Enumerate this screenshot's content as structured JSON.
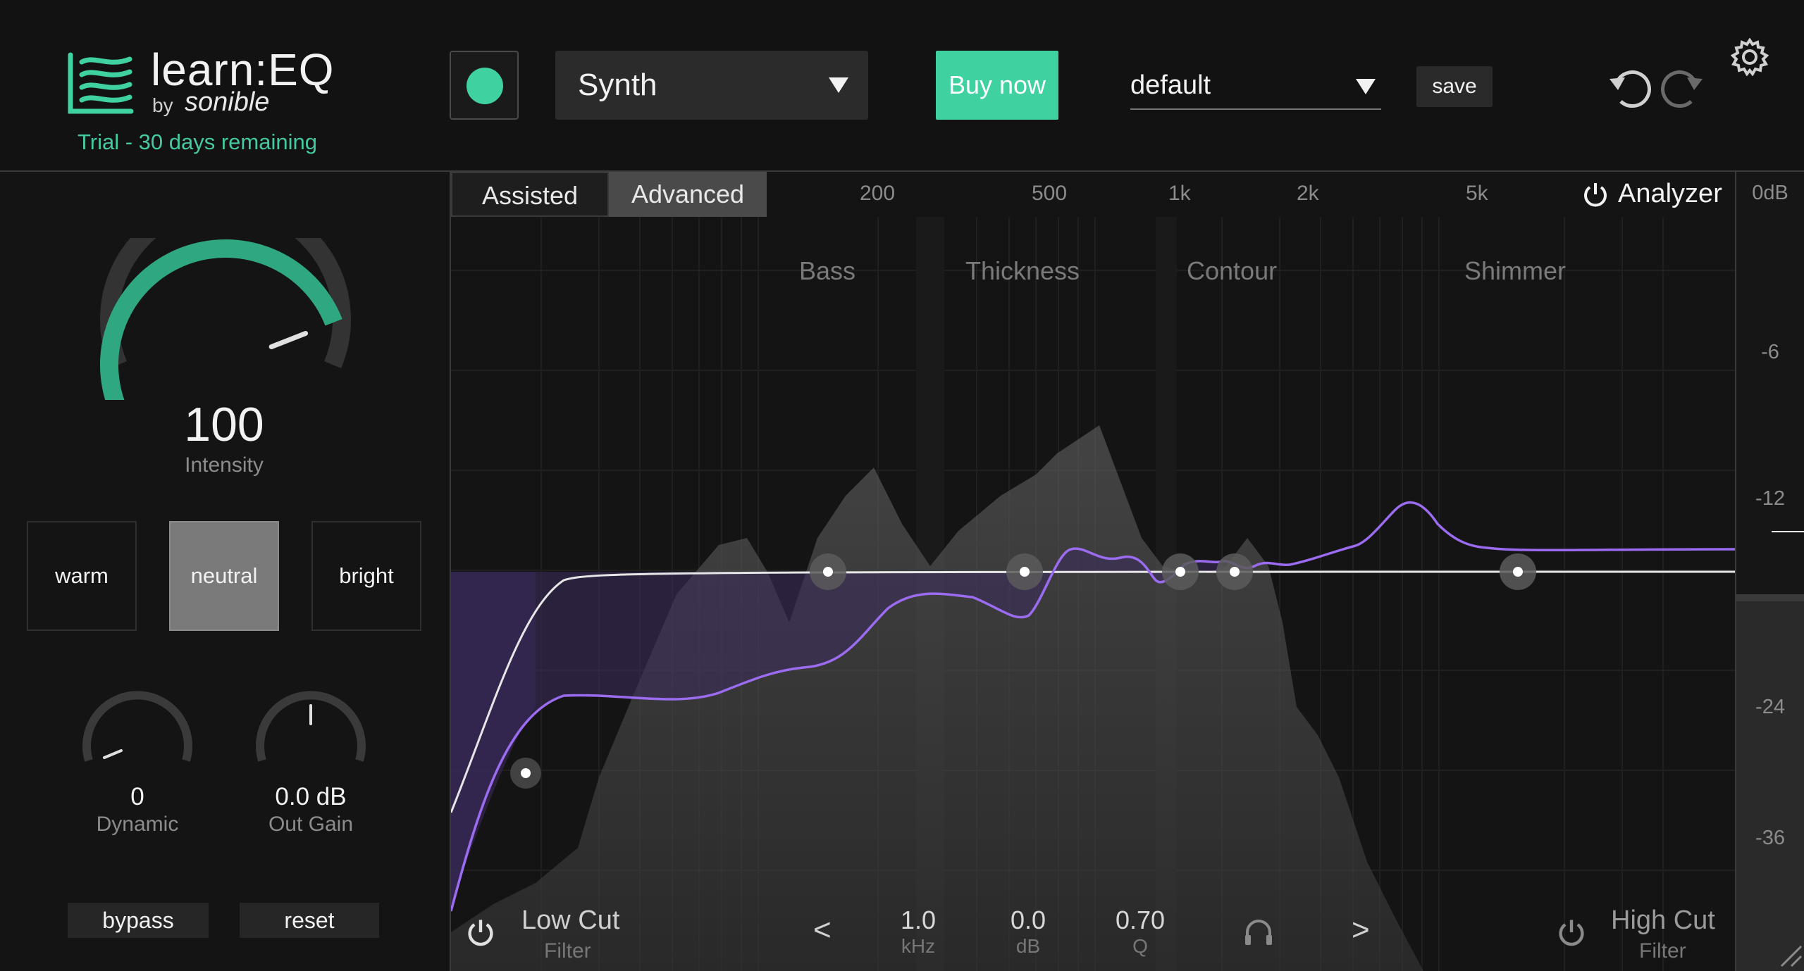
{
  "header": {
    "logo_name": "learn:EQ",
    "logo_by": "by",
    "logo_brand": "sonible",
    "trial_text": "Trial - 30 days remaining",
    "preset_selected": "Synth",
    "buy_label": "Buy now",
    "profile_selected": "default",
    "save_label": "save"
  },
  "left": {
    "intensity": {
      "value": "100",
      "label": "Intensity",
      "level_percent": 78
    },
    "tone_buttons": [
      {
        "label": "warm",
        "active": false
      },
      {
        "label": "neutral",
        "active": true
      },
      {
        "label": "bright",
        "active": false
      }
    ],
    "dynamic": {
      "value": "0",
      "label": "Dynamic",
      "level_percent": 0
    },
    "out_gain": {
      "value": "0.0 dB",
      "label": "Out Gain",
      "level_percent": 50
    },
    "bypass_label": "bypass",
    "reset_label": "reset"
  },
  "graph": {
    "tabs": [
      {
        "label": "Assisted",
        "active": false
      },
      {
        "label": "Advanced",
        "active": true
      }
    ],
    "freq_labels": [
      "200",
      "500",
      "1k",
      "2k",
      "5k"
    ],
    "bands": [
      "Bass",
      "Thickness",
      "Contour",
      "Shimmer"
    ],
    "analyzer_label": "Analyzer",
    "low_cut": {
      "name": "Low Cut",
      "sub": "Filter"
    },
    "high_cut": {
      "name": "High Cut",
      "sub": "Filter"
    },
    "params": [
      {
        "value": "1.0",
        "unit": "kHz"
      },
      {
        "value": "0.0",
        "unit": "dB"
      },
      {
        "value": "0.70",
        "unit": "Q"
      }
    ],
    "prev_label": "<",
    "next_label": ">"
  },
  "meter": {
    "db_labels": [
      "0dB",
      "-6",
      "-12",
      "-24",
      "-36"
    ]
  },
  "colors": {
    "accent": "#3fd1a0",
    "curve_purple": "#9b6cf0",
    "eq_line": "#e0e0e0"
  },
  "icons": [
    "logo-waves-icon",
    "record-dot-icon",
    "dropdown-caret-icon",
    "undo-icon",
    "redo-icon",
    "gear-icon",
    "power-icon",
    "headphones-icon",
    "resize-grip-icon"
  ]
}
